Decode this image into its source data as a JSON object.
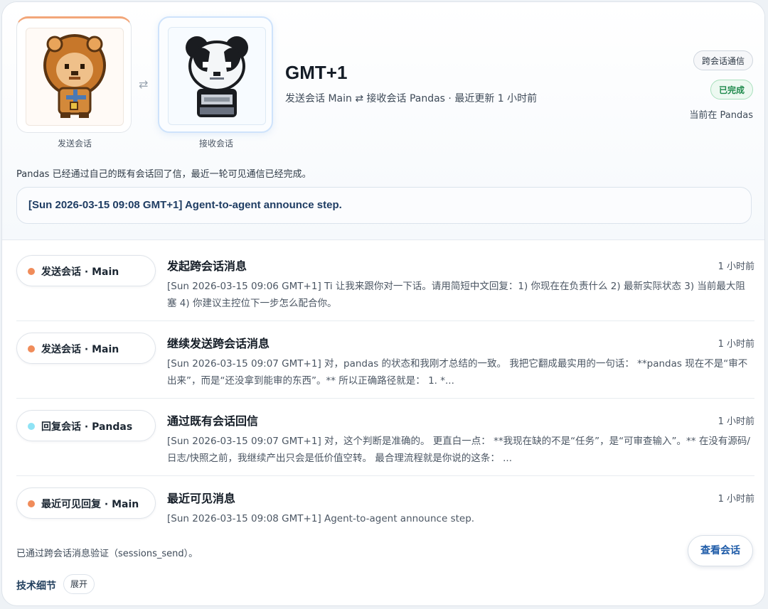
{
  "header": {
    "sender_caption": "发送会话",
    "receiver_caption": "接收会话",
    "swap_glyph": "⇄",
    "title": "GMT+1",
    "subtitle": "发送会话 Main ⇄ 接收会话 Pandas · 最近更新 1 小时前",
    "type_chip": "跨会话通信",
    "status_chip": "已完成",
    "current": "当前在 Pandas",
    "summary": "Pandas 已经通过自己的既有会话回了信，最近一轮可见通信已经完成。",
    "latest": "[Sun 2026-03-15 09:08 GMT+1] Agent-to-agent announce step."
  },
  "events": [
    {
      "pill": "发送会话 · Main",
      "dot_color": "#f08c5a",
      "title": "发起跨会话消息",
      "time": "1 小时前",
      "body": "[Sun 2026-03-15 09:06 GMT+1] Ti 让我来跟你对一下话。请用简短中文回复：1) 你现在在负责什么 2) 最新实际状态 3) 当前最大阻塞 4) 你建议主控位下一步怎么配合你。"
    },
    {
      "pill": "发送会话 · Main",
      "dot_color": "#f08c5a",
      "title": "继续发送跨会话消息",
      "time": "1 小时前",
      "body": "[Sun 2026-03-15 09:07 GMT+1] 对，pandas 的状态和我刚才总结的一致。 我把它翻成最实用的一句话： **pandas 现在不是“审不出来”，而是“还没拿到能审的东西”。** 所以正确路径就是： 1. *..."
    },
    {
      "pill": "回复会话 · Pandas",
      "dot_color": "#8fe3f5",
      "title": "通过既有会话回信",
      "time": "1 小时前",
      "body": "[Sun 2026-03-15 09:07 GMT+1] 对，这个判断是准确的。 更直白一点： **我现在缺的不是“任务”，是“可审查输入”。** 在没有源码/日志/快照之前，我继续产出只会是低价值空转。 最合理流程就是你说的这条： ..."
    },
    {
      "pill": "最近可见回复 · Main",
      "dot_color": "#f08c5a",
      "title": "最近可见消息",
      "time": "1 小时前",
      "body": "[Sun 2026-03-15 09:08 GMT+1] Agent-to-agent announce step."
    }
  ],
  "footer": {
    "verify": "已通过跨会话消息验证（sessions_send）。",
    "view_button": "查看会话",
    "tech_label": "技术细节",
    "expand_button": "展开"
  },
  "icons": {
    "sender_avatar": "lion-pixel-avatar",
    "receiver_avatar": "panda-pixel-avatar"
  }
}
